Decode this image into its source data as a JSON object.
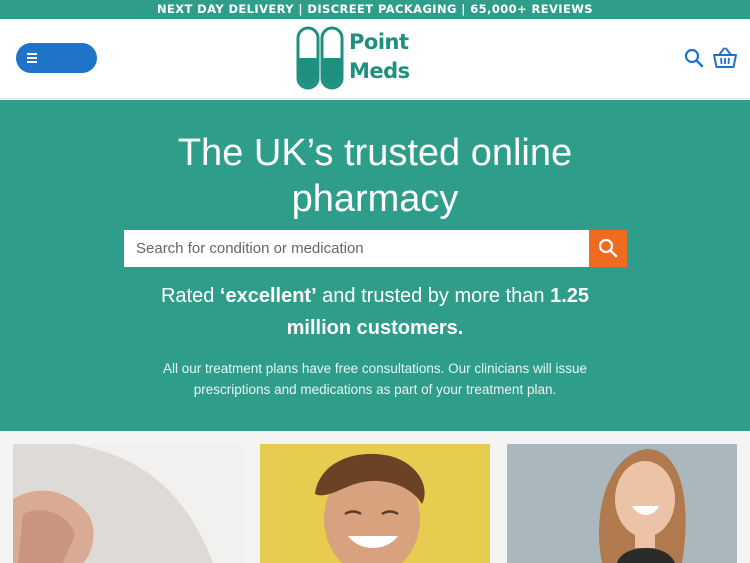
{
  "topbar": {
    "text": "NEXT DAY DELIVERY | DISCREET PACKAGING | 65,000+ REVIEWS"
  },
  "header": {
    "logo_line1": "Point",
    "logo_line2": "Meds"
  },
  "hero": {
    "title_line1": "The UK’s trusted online",
    "title_line2": "pharmacy",
    "search_placeholder": "Search for condition or medication",
    "rated_pre": "Rated ",
    "rated_emph": "‘excellent’",
    "rated_mid": " and trusted by more than ",
    "rated_count": "1.25",
    "rated_tail": "million customers.",
    "desc_line1": "All our treatment plans have free consultations. Our clinicians will issue",
    "desc_line2": "prescriptions and medications as part of your treatment plan."
  },
  "colors": {
    "brand_teal": "#2e9e8a",
    "menu_blue": "#1f73c8",
    "search_orange": "#ef6b1f"
  },
  "icons": [
    "menu-icon",
    "capsule-logo-icon",
    "search-icon",
    "basket-icon"
  ]
}
